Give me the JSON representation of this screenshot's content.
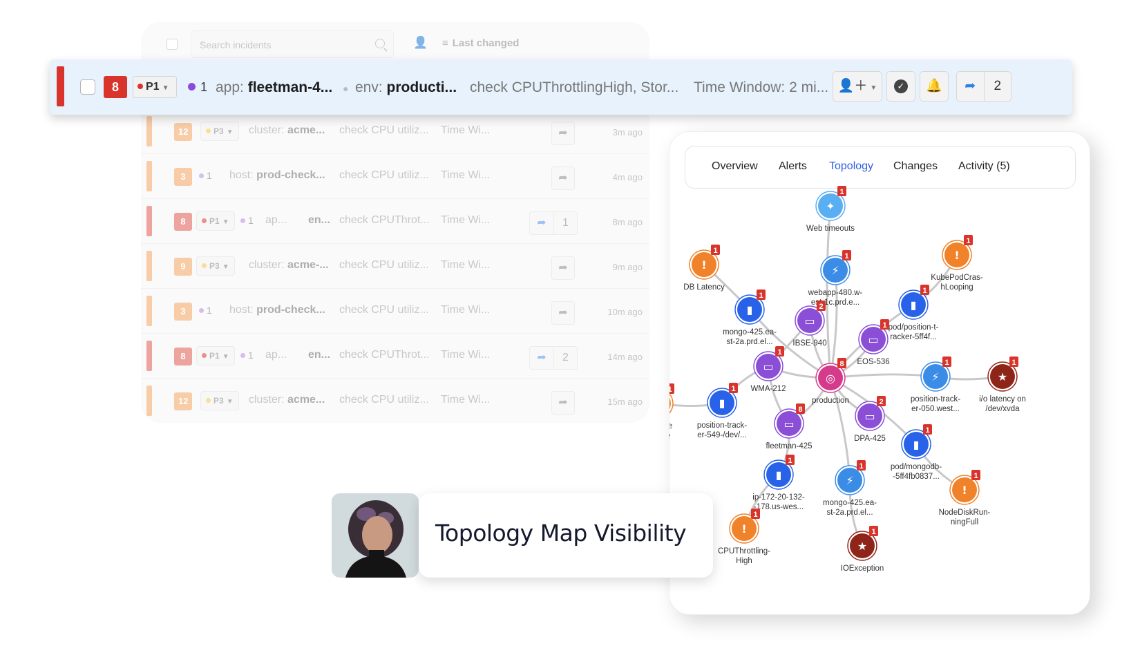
{
  "toolbar": {
    "search_placeholder": "Search incidents",
    "sort_label": "Last changed",
    "sort_icon": "list-sort-icon",
    "assignee_icon": "user-icon"
  },
  "highlighted_incident": {
    "alert_count": "8",
    "priority": "P1",
    "priority_color": "#d9342b",
    "linked_count": "1",
    "app_key": "app:",
    "app_value": "fleetman-4...",
    "env_key": "env:",
    "env_value": "producti...",
    "check": "check CPUThrottlingHigh, Stor...",
    "time_window": "Time Window: 2 mi...",
    "actions": {
      "assign_icon": "user-plus-icon",
      "resolve_icon": "check-circle-icon",
      "notify_icon": "bell-icon",
      "share_icon": "share-arrow-icon",
      "share_count": "2"
    }
  },
  "incidents": [
    {
      "count": "12",
      "color": "#f2a35f",
      "priority": "P3",
      "prio_dot": "#f4c542",
      "linked": "",
      "key": "cluster:",
      "value": "acme...",
      "check": "check CPU utiliz...",
      "window": "Time Wi...",
      "share_count": "",
      "time": "3m ago"
    },
    {
      "count": "3",
      "color": "#f2a35f",
      "priority": "",
      "prio_dot": "",
      "linked": "1",
      "key": "host:",
      "value": "prod-check...",
      "check": "check CPU utiliz...",
      "window": "Time Wi...",
      "share_count": "",
      "time": "4m ago"
    },
    {
      "count": "8",
      "color": "#e15a50",
      "priority": "P1",
      "prio_dot": "#d9342b",
      "linked": "1",
      "key": "ap...",
      "value": "en...",
      "check": "check CPUThrot...",
      "window": "Time Wi...",
      "share_count": "1",
      "time": "8m ago"
    },
    {
      "count": "9",
      "color": "#f2a35f",
      "priority": "P3",
      "prio_dot": "#f4c542",
      "linked": "",
      "key": "cluster:",
      "value": "acme-...",
      "check": "check CPU utiliz...",
      "window": "Time Wi...",
      "share_count": "",
      "time": "9m ago"
    },
    {
      "count": "3",
      "color": "#f2a35f",
      "priority": "",
      "prio_dot": "",
      "linked": "1",
      "key": "host:",
      "value": "prod-check...",
      "check": "check CPU utiliz...",
      "window": "Time Wi...",
      "share_count": "",
      "time": "10m ago"
    },
    {
      "count": "8",
      "color": "#e15a50",
      "priority": "P1",
      "prio_dot": "#d9342b",
      "linked": "1",
      "key": "ap...",
      "value": "en...",
      "check": "check CPUThrot...",
      "window": "Time Wi...",
      "share_count": "2",
      "time": "14m ago"
    },
    {
      "count": "12",
      "color": "#f2a35f",
      "priority": "P3",
      "prio_dot": "#f4c542",
      "linked": "",
      "key": "cluster:",
      "value": "acme...",
      "check": "check CPU utiliz...",
      "window": "Time Wi...",
      "share_count": "",
      "time": "15m ago"
    }
  ],
  "topology": {
    "tabs": [
      {
        "label": "Overview",
        "active": false
      },
      {
        "label": "Alerts",
        "active": false
      },
      {
        "label": "Topology",
        "active": true
      },
      {
        "label": "Changes",
        "active": false
      },
      {
        "label": "Activity (5)",
        "active": false
      }
    ],
    "colors": {
      "alert": "#f0822a",
      "host": "#2862e8",
      "lambda": "#3b8ce6",
      "app": "#8a4fd6",
      "env": "#d63a8a",
      "error": "#8f2518",
      "pin": "#5aaef2",
      "badge": "#d9342b"
    },
    "nodes": [
      {
        "id": "web-timeouts",
        "label": [
          "Web timeouts"
        ],
        "type": "pin",
        "badge": "1"
      },
      {
        "id": "db-latency",
        "label": [
          "DB Latency"
        ],
        "type": "alert",
        "badge": "1"
      },
      {
        "id": "kube-pod",
        "label": [
          "KubePodCras-",
          "hLooping"
        ],
        "type": "alert",
        "badge": "1"
      },
      {
        "id": "webapp-480",
        "label": [
          "webapp-480.w-",
          "est-1c.prd.e..."
        ],
        "type": "lambda",
        "badge": "1"
      },
      {
        "id": "mongo-425-a",
        "label": [
          "mongo-425.ea-",
          "st-2a.prd.el..."
        ],
        "type": "host",
        "badge": "1"
      },
      {
        "id": "ibse-940",
        "label": [
          "IBSE-940"
        ],
        "type": "app",
        "badge": "2"
      },
      {
        "id": "pod-position",
        "label": [
          "pod/position-t-",
          "racker-5ff4f..."
        ],
        "type": "host",
        "badge": "1"
      },
      {
        "id": "eos-536",
        "label": [
          "EOS-536"
        ],
        "type": "app",
        "badge": "1"
      },
      {
        "id": "wma-212",
        "label": [
          "WMA-212"
        ],
        "type": "app",
        "badge": "1"
      },
      {
        "id": "production",
        "label": [
          "production"
        ],
        "type": "env",
        "badge": "8"
      },
      {
        "id": "position-050",
        "label": [
          "position-track-",
          "er-050.west..."
        ],
        "type": "lambda",
        "badge": "1"
      },
      {
        "id": "io-latency",
        "label": [
          "i/o latency on",
          "/dev/xvda"
        ],
        "type": "error",
        "badge": "1"
      },
      {
        "id": "storage-failure",
        "label": [
          "Storage",
          "Failure"
        ],
        "type": "alert",
        "badge": "1"
      },
      {
        "id": "position-549",
        "label": [
          "position-track-",
          "er-549-/dev/..."
        ],
        "type": "host",
        "badge": "1"
      },
      {
        "id": "fleetman-425",
        "label": [
          "fleetman-425"
        ],
        "type": "app",
        "badge": "8"
      },
      {
        "id": "dpa-425",
        "label": [
          "DPA-425"
        ],
        "type": "app",
        "badge": "2"
      },
      {
        "id": "pod-mongodb",
        "label": [
          "pod/mongodb-",
          "-5ff4fb0837..."
        ],
        "type": "host",
        "badge": "1"
      },
      {
        "id": "ip-172",
        "label": [
          "ip-172-20-132-",
          "-178.us-wes..."
        ],
        "type": "host",
        "badge": "1"
      },
      {
        "id": "mongo-425-b",
        "label": [
          "mongo-425.ea-",
          "st-2a.prd.el..."
        ],
        "type": "lambda",
        "badge": "1"
      },
      {
        "id": "node-disk",
        "label": [
          "NodeDiskRun-",
          "ningFull"
        ],
        "type": "alert",
        "badge": "1"
      },
      {
        "id": "cpu-throttling",
        "label": [
          "CPUThrottling-",
          "High"
        ],
        "type": "alert",
        "badge": "1"
      },
      {
        "id": "ioexception",
        "label": [
          "IOException"
        ],
        "type": "error",
        "badge": "1"
      }
    ],
    "edges": [
      [
        "web-timeouts",
        "production"
      ],
      [
        "db-latency",
        "mongo-425-a"
      ],
      [
        "mongo-425-a",
        "production"
      ],
      [
        "webapp-480",
        "production"
      ],
      [
        "ibse-940",
        "production"
      ],
      [
        "kube-pod",
        "pod-position"
      ],
      [
        "pod-position",
        "production"
      ],
      [
        "eos-536",
        "production"
      ],
      [
        "wma-212",
        "production"
      ],
      [
        "position-050",
        "production"
      ],
      [
        "io-latency",
        "position-050"
      ],
      [
        "storage-failure",
        "position-549"
      ],
      [
        "position-549",
        "wma-212"
      ],
      [
        "fleetman-425",
        "production"
      ],
      [
        "dpa-425",
        "production"
      ],
      [
        "pod-mongodb",
        "production"
      ],
      [
        "node-disk",
        "pod-mongodb"
      ],
      [
        "ip-172",
        "fleetman-425"
      ],
      [
        "cpu-throttling",
        "ip-172"
      ],
      [
        "mongo-425-b",
        "production"
      ],
      [
        "ioexception",
        "mongo-425-b"
      ],
      [
        "wma-212",
        "ibse-940"
      ],
      [
        "fleetman-425",
        "wma-212"
      ]
    ]
  },
  "caption": {
    "title": "Topology Map Visibility",
    "avatar": "person-photo"
  }
}
